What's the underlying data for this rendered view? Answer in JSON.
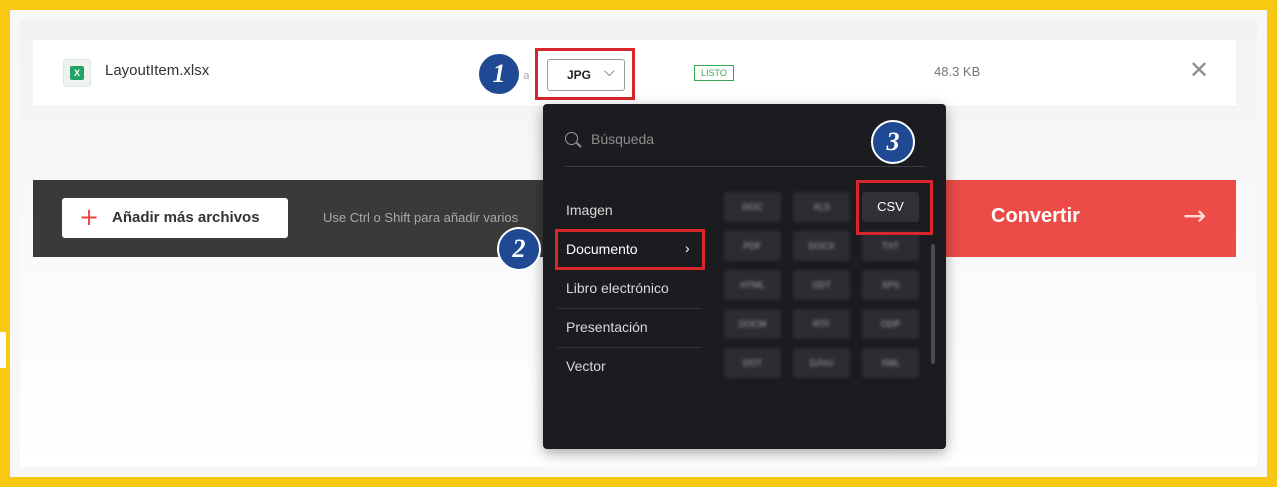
{
  "file": {
    "name": "LayoutItem.xlsx",
    "format_selected": "JPG",
    "status": "LISTO",
    "size": "48.3 KB",
    "stray_text": "a"
  },
  "toolbar": {
    "add_label": "Añadir más archivos",
    "hint": "Use Ctrl o Shift para añadir varios",
    "convert_label": "Convertir"
  },
  "dropdown": {
    "search_placeholder": "Búsqueda",
    "categories": [
      "Imagen",
      "Documento",
      "Libro electrónico",
      "Presentación",
      "Vector"
    ],
    "active_category": "Documento",
    "formats": [
      "DOC",
      "XLS",
      "CSV",
      "PDF",
      "DOCX",
      "TXT",
      "HTML",
      "ODT",
      "XPS",
      "DOCM",
      "RTF",
      "ODP",
      "DOT",
      "DJVU",
      "XML"
    ],
    "selected_format": "CSV"
  },
  "badges": [
    "1",
    "2",
    "3"
  ],
  "colors": {
    "frame": "#f7c912",
    "highlight": "#d9252c",
    "badge": "#1f4a93",
    "convert": "#ec4b47",
    "ready": "#34a853"
  }
}
